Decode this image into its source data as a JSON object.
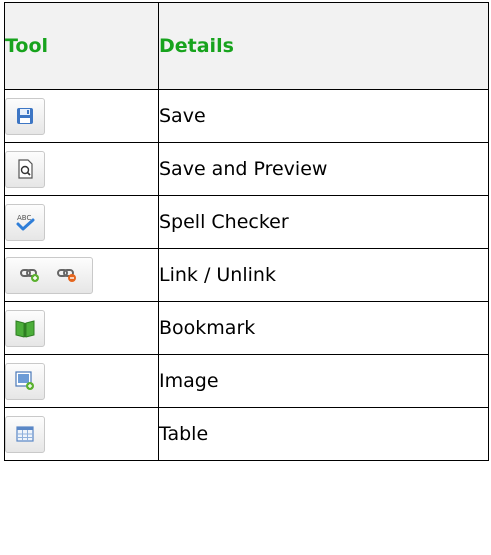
{
  "header": {
    "tool": "Tool",
    "details": "Details"
  },
  "rows": [
    {
      "icon": "save-icon",
      "label": "Save"
    },
    {
      "icon": "save-preview-icon",
      "label": "Save and Preview"
    },
    {
      "icon": "spell-checker-icon",
      "label": "Spell Checker"
    },
    {
      "icon": "link-unlink-icon",
      "label": "Link / Unlink"
    },
    {
      "icon": "bookmark-icon",
      "label": "Bookmark"
    },
    {
      "icon": "image-icon",
      "label": "Image"
    },
    {
      "icon": "table-icon",
      "label": "Table"
    }
  ],
  "colors": {
    "header_text": "#17a31d",
    "header_bg": "#f2f2f2",
    "border": "#000000"
  }
}
